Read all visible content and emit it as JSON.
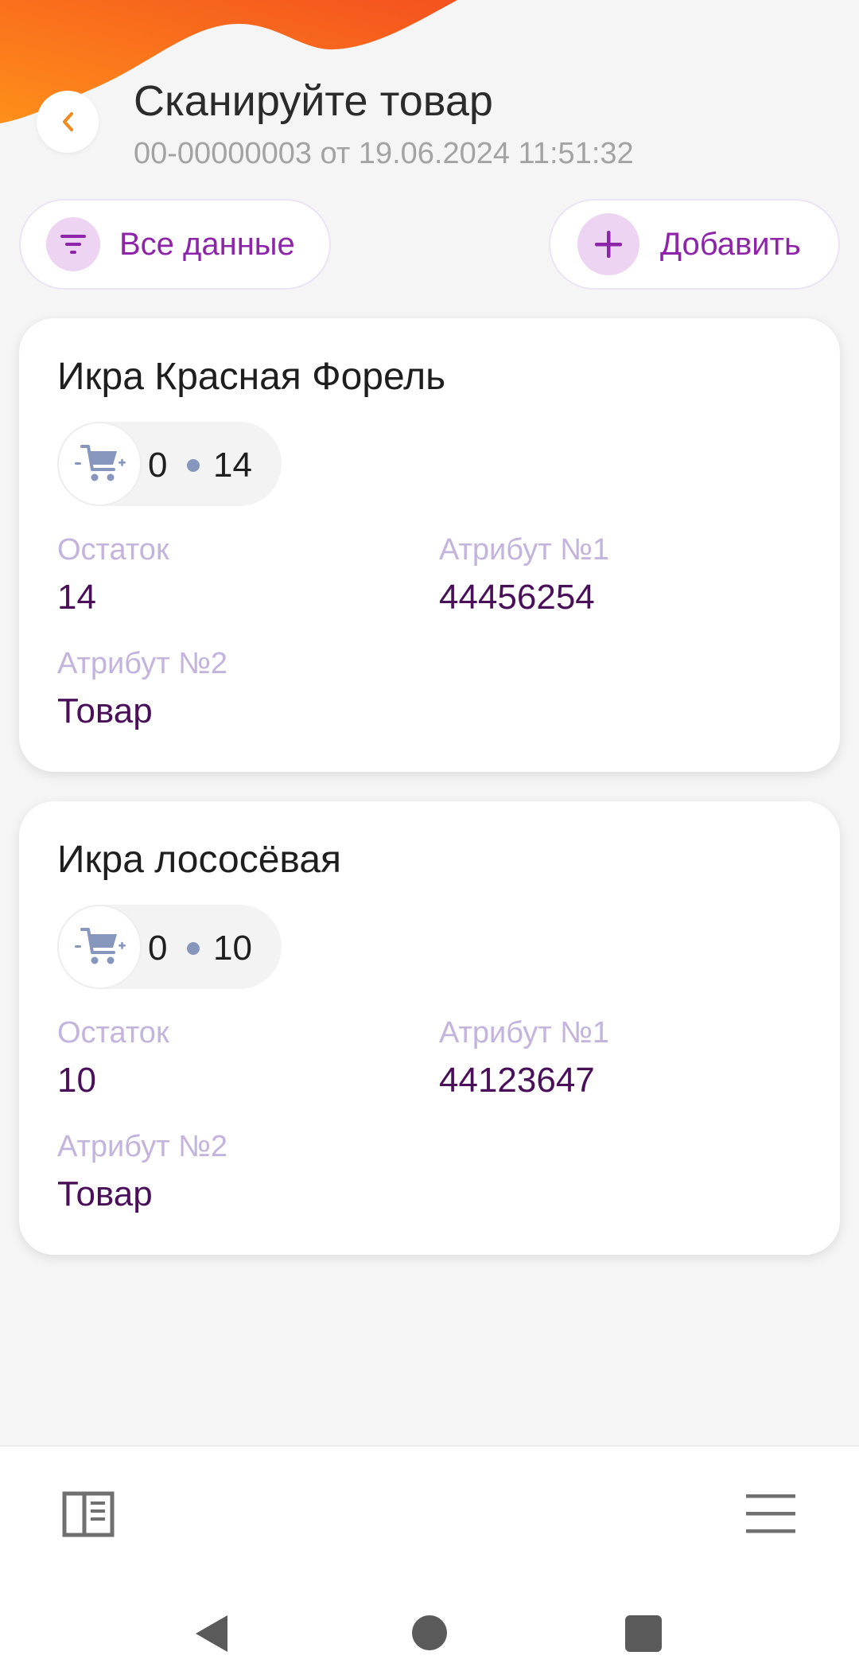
{
  "header": {
    "title": "Сканируйте товар",
    "subtitle": "00-00000003 от 19.06.2024 11:51:32",
    "back_icon": "chevron-left-icon"
  },
  "toolbar": {
    "filter_label": "Все данные",
    "filter_icon": "filter-icon",
    "add_label": "Добавить",
    "add_icon": "plus-icon"
  },
  "products": [
    {
      "name": "Икра Красная Форель",
      "qty_scanned": "0",
      "qty_total": "14",
      "stock_label": "Остаток",
      "stock_value": "14",
      "attr1_label": "Атрибут №1",
      "attr1_value": "44456254",
      "attr2_label": "Атрибут №2",
      "attr2_value": "Товар"
    },
    {
      "name": "Икра лососёвая",
      "qty_scanned": "0",
      "qty_total": "10",
      "stock_label": "Остаток",
      "stock_value": "10",
      "attr1_label": "Атрибут №1",
      "attr1_value": "44123647",
      "attr2_label": "Атрибут №2",
      "attr2_value": "Товар"
    }
  ],
  "bottom_nav": {
    "left_icon": "side-panel-icon",
    "right_icon": "hamburger-menu-icon"
  },
  "colors": {
    "accent": "#8e24aa",
    "accent_light": "#edd4f2",
    "header_gradient_start": "#ff8a1c",
    "header_gradient_end": "#f4511e",
    "label": "#c3b4dd",
    "value": "#4a0f59",
    "cart_icon": "#8796bd"
  }
}
